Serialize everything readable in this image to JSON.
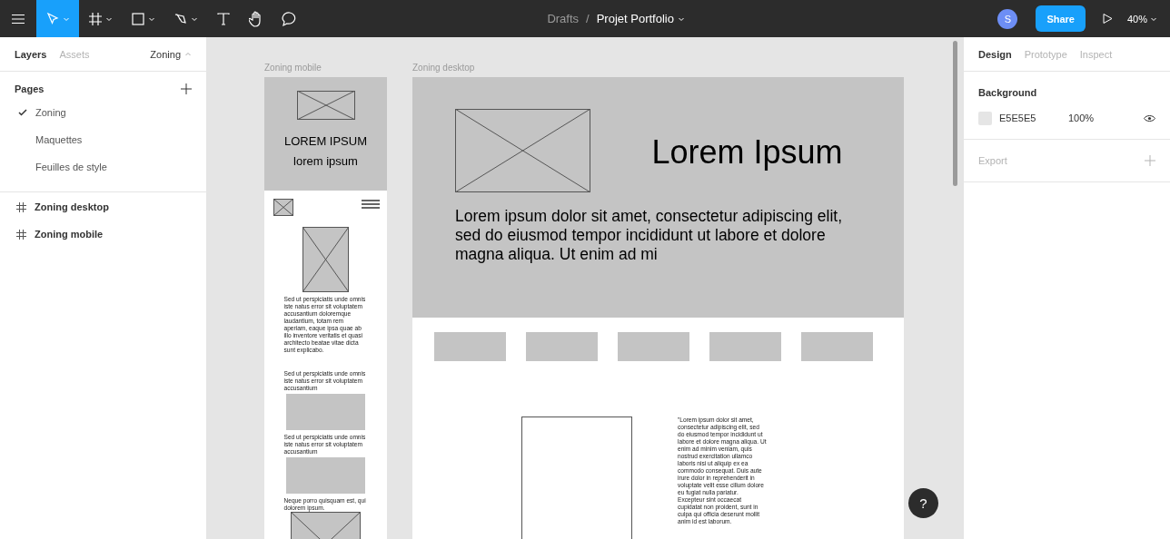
{
  "toolbar": {
    "tools": [
      {
        "kind": "move",
        "selected": true
      },
      {
        "kind": "frame",
        "selected": false
      },
      {
        "kind": "shape",
        "selected": false
      },
      {
        "kind": "pen",
        "selected": false
      },
      {
        "kind": "text",
        "selected": false
      },
      {
        "kind": "hand",
        "selected": false
      },
      {
        "kind": "comment",
        "selected": false
      }
    ],
    "breadcrumb": {
      "folder": "Drafts",
      "separator": "/",
      "file": "Projet Portfolio"
    },
    "avatar": "S",
    "share": "Share",
    "zoom": "40%"
  },
  "left_panel": {
    "tabs": [
      {
        "label": "Layers",
        "selected": true
      },
      {
        "label": "Assets",
        "selected": false
      }
    ],
    "page_selector": "Zoning",
    "pages": {
      "title": "Pages",
      "items": [
        {
          "label": "Zoning",
          "selected": true
        },
        {
          "label": "Maquettes",
          "selected": false
        },
        {
          "label": "Feuilles de style",
          "selected": false
        }
      ]
    },
    "layers": [
      {
        "name": "Zoning desktop"
      },
      {
        "name": "Zoning mobile"
      }
    ]
  },
  "canvas": {
    "mobile": {
      "label": "Zoning mobile",
      "title": "LOREM IPSUM",
      "subtitle": "lorem ipsum",
      "blocks": [
        {
          "kind": "image"
        },
        {
          "kind": "text",
          "text": "Sed ut perspiciatis unde omnis iste natus error sit voluptatem accusantium doloremque laudantium, totam rem aperiam, eaque ipsa quae ab illo inventore veritatis et quasi architecto beatae vitae dicta sunt explicabo."
        },
        {
          "kind": "spacer"
        },
        {
          "kind": "text",
          "text": "Sed ut perspiciatis unde omnis iste natus error sit voluptatem accusantium"
        },
        {
          "kind": "box"
        },
        {
          "kind": "text",
          "text": "Sed ut perspiciatis unde omnis iste natus error sit voluptatem accusantium"
        },
        {
          "kind": "box"
        },
        {
          "kind": "text",
          "text": "Neque porro quisquam est, qui dolorem ipsum."
        },
        {
          "kind": "image"
        }
      ]
    },
    "desktop": {
      "label": "Zoning desktop",
      "title": "Lorem Ipsum",
      "paragraph": "Lorem ipsum dolor sit amet, consectetur adipiscing elit, sed do eiusmod tempor incididunt ut labore et dolore magna aliqua. Ut enim ad mi",
      "nav": [
        {
          "kind": "box"
        },
        {
          "kind": "box"
        },
        {
          "kind": "box"
        },
        {
          "kind": "box"
        },
        {
          "kind": "box"
        }
      ],
      "content": [
        {
          "kind": "frame"
        },
        {
          "kind": "text",
          "text": "\"Lorem ipsum dolor sit amet, consectetur adipiscing elit, sed do eiusmod tempor incididunt ut labore et dolore magna aliqua. Ut enim ad minim veniam, quis nostrud exercitation ullamco laboris nisi ut aliquip ex ea commodo consequat. Duis aute irure dolor in reprehenderit in voluptate velit esse cillum dolore eu fugiat nulla pariatur. Excepteur sint occaecat cupidatat non proident, sunt in culpa qui officia deserunt mollit anim id est laborum."
        }
      ]
    }
  },
  "right_panel": {
    "tabs": [
      {
        "label": "Design",
        "selected": true
      },
      {
        "label": "Prototype",
        "selected": false
      },
      {
        "label": "Inspect",
        "selected": false
      }
    ],
    "background": {
      "title": "Background",
      "color": "E5E5E5",
      "opacity": "100%"
    },
    "export": {
      "title": "Export"
    }
  },
  "help": "?"
}
